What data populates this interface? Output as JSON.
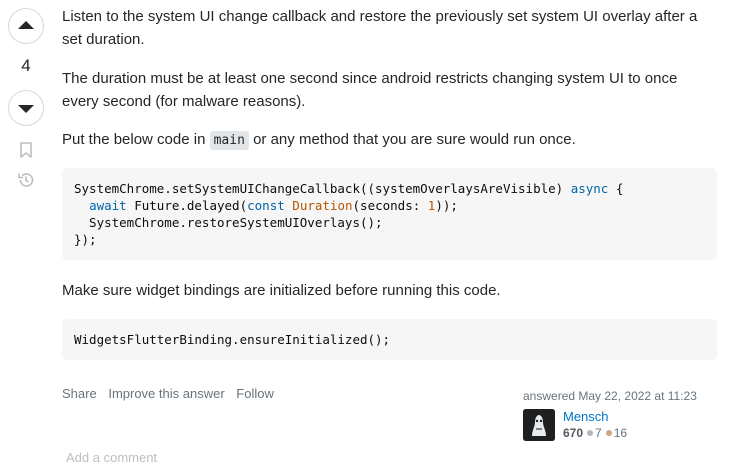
{
  "vote": {
    "count": "4"
  },
  "answer": {
    "para1": "Listen to the system UI change callback and restore the previously set system UI overlay after a set duration.",
    "para2": "The duration must be at least one second since android restricts changing system UI to once every second (for malware reasons).",
    "para3_before": "Put the below code in ",
    "para3_code": "main",
    "para3_after": " or any method that you are sure would run once.",
    "code1": {
      "l1_a": "SystemChrome.setSystemUIChangeCallback((systemOverlaysAreVisible) ",
      "l1_kw": "async",
      "l1_b": " {",
      "l2_indent": "  ",
      "l2_kw1": "await",
      "l2_a": " Future.delayed(",
      "l2_kw2": "const",
      "l2_sp": " ",
      "l2_ty": "Duration",
      "l2_b": "(seconds: ",
      "l2_num": "1",
      "l2_c": "));",
      "l3": "  SystemChrome.restoreSystemUIOverlays();",
      "l4": "});"
    },
    "para4": "Make sure widget bindings are initialized before running this code.",
    "code2": "WidgetsFlutterBinding.ensureInitialized();"
  },
  "menu": {
    "share": "Share",
    "improve": "Improve this answer",
    "follow": "Follow"
  },
  "signature": {
    "answered_label": "answered ",
    "answered_time": "May 22, 2022 at 11:23",
    "user_name": "Mensch",
    "reputation": "670",
    "silver_badges": "7",
    "bronze_badges": "16"
  },
  "comment": {
    "add_label": "Add a comment"
  },
  "icons": [
    "up-arrow-icon",
    "down-arrow-icon",
    "bookmark-icon",
    "history-icon"
  ],
  "colors": {
    "link": "#0074cc",
    "muted": "#6a737c",
    "code_bg": "#f6f6f6",
    "keyword": "#0064a8",
    "type": "#b75501"
  }
}
